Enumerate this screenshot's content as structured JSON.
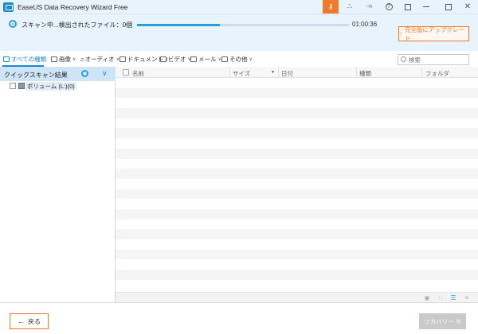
{
  "window": {
    "title": "EaseUS Data Recovery Wizard Free",
    "icons": {
      "key": "key-icon",
      "share": "share-icon",
      "signin": "sign-in-icon",
      "help": "help-icon",
      "feedback": "feedback-icon",
      "minimize": "minimize-icon",
      "maximize": "maximize-icon",
      "close": "close-icon"
    },
    "colors": {
      "accent": "#2a9fd8",
      "brand_orange": "#f07a2c",
      "titlebar_bg": "#e9f3fb"
    }
  },
  "scan": {
    "status_text": "スキャン中...検出されたファイル：0個",
    "progress": 0.39,
    "elapsed": "01:00:36",
    "upgrade_label": "完全版にアップグレード"
  },
  "filters": {
    "items": [
      {
        "label": "すべての種類",
        "icon": "monitor-icon",
        "active": true
      },
      {
        "label": "画像",
        "icon": "image-icon"
      },
      {
        "label": "オーディオ",
        "icon": "music-icon"
      },
      {
        "label": "ドキュメント",
        "icon": "document-icon"
      },
      {
        "label": "ビデオ",
        "icon": "video-icon"
      },
      {
        "label": "メール",
        "icon": "mail-icon"
      },
      {
        "label": "その他",
        "icon": "folder-icon"
      }
    ],
    "search_placeholder": "検索"
  },
  "sidebar": {
    "header": "クイックスキャン結果",
    "items": [
      {
        "label": "ボリューム (L:)(0)"
      }
    ]
  },
  "table": {
    "columns": [
      "名前",
      "サイズ",
      "日付",
      "種類",
      "フォルダ"
    ],
    "rows": []
  },
  "footer": {
    "back_label": "戻る",
    "recover_label": "リカバリー"
  }
}
